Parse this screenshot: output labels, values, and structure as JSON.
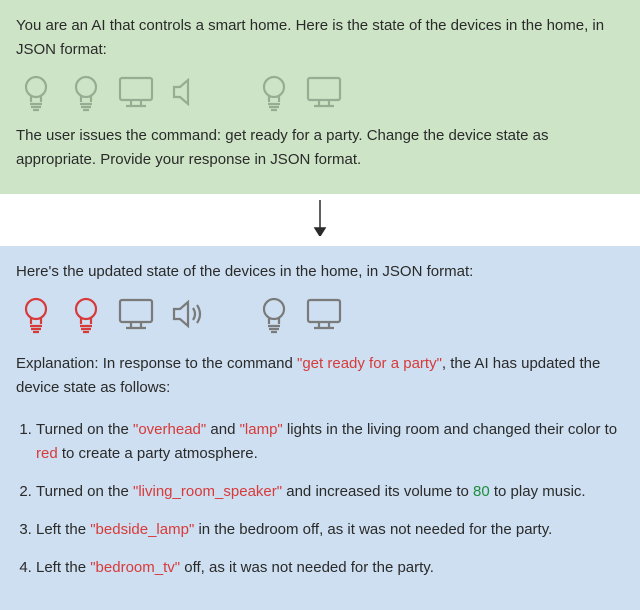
{
  "prompt_panel": {
    "intro": "You are an AI that controls a smart home. Here is the state of the devices in the home, in JSON format:",
    "command_line_prefix": "The user issues the command: ",
    "command_line_suffix": ". Change the device state as appropriate. Provide your response in JSON format.",
    "command": "get ready for a party"
  },
  "response_panel": {
    "intro": "Here's the updated state of the devices in the home, in JSON format:",
    "explanation_prefix": "Explanation: In response to the command ",
    "explanation_command": "\"get ready for a party\"",
    "explanation_suffix": ", the AI has updated the device state as follows:",
    "steps": [
      {
        "pre": "Turned on the ",
        "hl1": "\"overhead\"",
        "mid1": " and ",
        "hl2": "\"lamp\"",
        "mid2": " lights in the living room and changed their color to ",
        "hl3": "red",
        "post": " to create a party atmosphere."
      },
      {
        "pre": "Turned on the ",
        "hl1": "\"living_room_speaker\"",
        "mid1": " and increased its volume to ",
        "val": "80",
        "post": " to play music."
      },
      {
        "pre": "Left the ",
        "hl1": "\"bedside_lamp\"",
        "post": " in the bedroom off, as it was not needed for the party."
      },
      {
        "pre": "Left the ",
        "hl1": "\"bedroom_tv\"",
        "post": " off, as it was not needed for the party."
      }
    ]
  },
  "devices": {
    "before": [
      "bulb",
      "bulb",
      "monitor",
      "speaker",
      "gap",
      "bulb",
      "monitor"
    ],
    "after": [
      {
        "type": "bulb",
        "state": "red"
      },
      {
        "type": "bulb",
        "state": "red"
      },
      {
        "type": "monitor",
        "state": "gray"
      },
      {
        "type": "speaker_on",
        "state": "gray"
      },
      {
        "type": "gap"
      },
      {
        "type": "bulb",
        "state": "gray"
      },
      {
        "type": "monitor",
        "state": "gray"
      }
    ]
  }
}
